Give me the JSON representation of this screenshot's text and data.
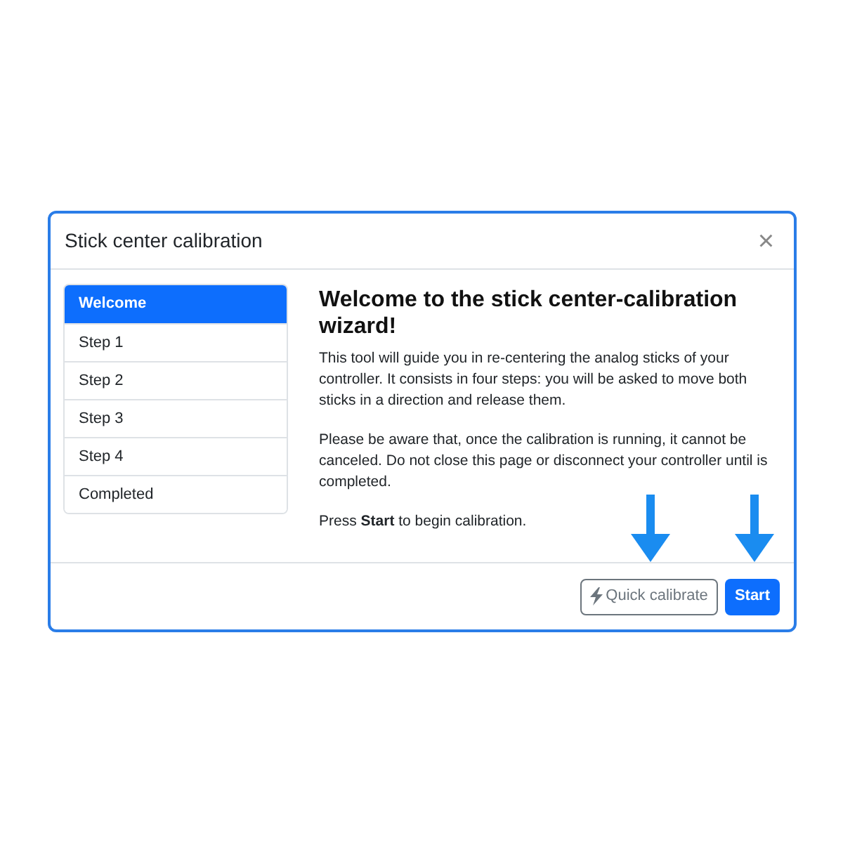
{
  "dialog": {
    "title": "Stick center calibration",
    "close": "×"
  },
  "steps": [
    {
      "label": "Welcome",
      "selected": true
    },
    {
      "label": "Step 1",
      "selected": false
    },
    {
      "label": "Step 2",
      "selected": false
    },
    {
      "label": "Step 3",
      "selected": false
    },
    {
      "label": "Step 4",
      "selected": false
    },
    {
      "label": "Completed",
      "selected": false
    }
  ],
  "content": {
    "heading": "Welcome to the stick center-calibration wizard!",
    "paragraphs": [
      "This tool will guide you in re-centering the analog sticks of your controller. It consists in four steps: you will be asked to move both sticks in a direction and release them.",
      "Please be aware that, once the calibration is running, it cannot be canceled. Do not close this page or disconnect your controller until is completed.",
      "Press **Start** to begin calibration."
    ]
  },
  "footer": {
    "quick_button": "Quick calibrate",
    "start_button": "Start"
  }
}
